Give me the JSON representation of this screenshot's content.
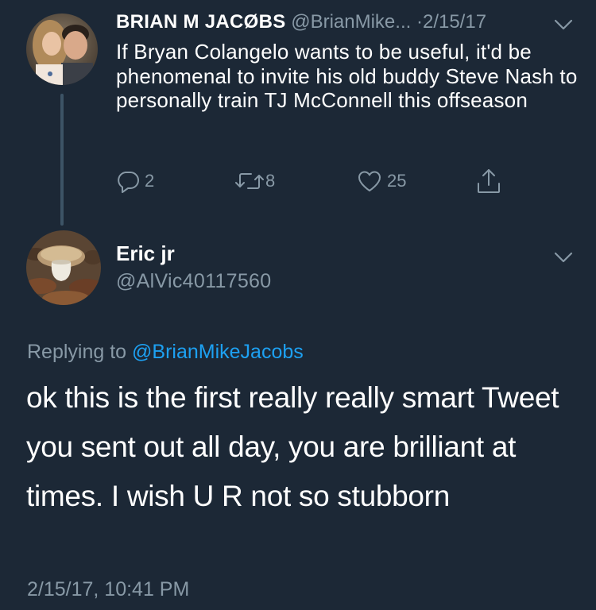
{
  "parent_tweet": {
    "display_name": "BRIAN M JACØBS",
    "handle": "@BrianMike...",
    "separator": "·",
    "date": "2/15/17",
    "text": "If Bryan Colangelo wants to be useful, it'd be phenomenal to invite his old buddy Steve Nash to personally train TJ McConnell this offseason",
    "actions": {
      "reply_icon": "reply-bubble-icon",
      "reply_count": "2",
      "retweet_icon": "retweet-icon",
      "retweet_count": "8",
      "like_icon": "heart-icon",
      "like_count": "25",
      "share_icon": "share-upload-icon"
    },
    "menu_icon": "chevron-down-icon"
  },
  "reply_tweet": {
    "display_name": "Eric jr",
    "handle": "@AlVic40117560",
    "menu_icon": "chevron-down-icon",
    "replying_to_prefix": "Replying to",
    "replying_to_handle": "@BrianMikeJacobs",
    "text": "ok this is the first really really smart Tweet you sent out all day, you are brilliant at times. I wish U R not so stubborn",
    "timestamp": "2/15/17, 10:41 PM"
  },
  "colors": {
    "background": "#1c2836",
    "primary_text": "#ffffff",
    "secondary_text": "#8899a6",
    "link": "#1da1f2",
    "thread_line": "#3d5466"
  }
}
